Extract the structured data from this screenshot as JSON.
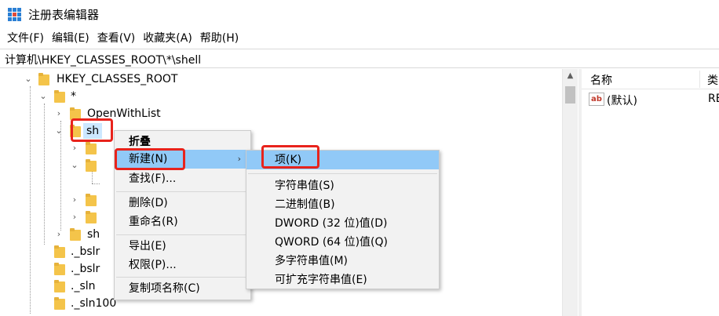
{
  "window": {
    "title": "注册表编辑器",
    "icon": "registry-editor-icon"
  },
  "menubar": {
    "items": [
      {
        "label": "文件(F)"
      },
      {
        "label": "编辑(E)"
      },
      {
        "label": "查看(V)"
      },
      {
        "label": "收藏夹(A)"
      },
      {
        "label": "帮助(H)"
      }
    ]
  },
  "address": {
    "path": "计算机\\HKEY_CLASSES_ROOT\\*\\shell"
  },
  "tree": {
    "root": "HKEY_CLASSES_ROOT",
    "star": "*",
    "openwithlist": "OpenWithList",
    "shell_selected": "sh",
    "sh2": "sh",
    "bslr1": "._bslr",
    "bslr2": "._bslr",
    "sln": "._sln",
    "sln100": "._sln100"
  },
  "rightpane": {
    "col_name": "名称",
    "col_type": "类",
    "rows": [
      {
        "name": "(默认)",
        "type": "RE",
        "icon": "string-value-icon"
      }
    ]
  },
  "context_menu": {
    "collapse": "折叠",
    "new": "新建(N)",
    "find": "查找(F)...",
    "delete": "删除(D)",
    "rename": "重命名(R)",
    "export": "导出(E)",
    "permissions": "权限(P)...",
    "copy_key_name": "复制项名称(C)"
  },
  "submenu": {
    "key": "项(K)",
    "string_value": "字符串值(S)",
    "binary_value": "二进制值(B)",
    "dword_value": "DWORD (32 位)值(D)",
    "qword_value": "QWORD (64 位)值(Q)",
    "multi_string_value": "多字符串值(M)",
    "expandable_string_value": "可扩充字符串值(E)"
  },
  "colors": {
    "highlight": "#91c9f7",
    "annotation": "#e8231c",
    "folder": "#f4c44a"
  }
}
